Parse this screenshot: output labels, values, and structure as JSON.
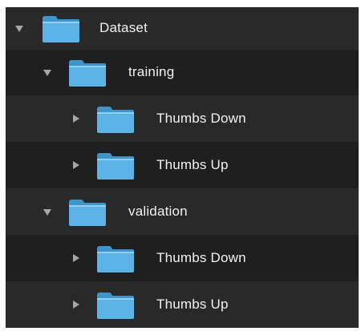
{
  "colors": {
    "background": "#1f1f1f",
    "row_alternate": "#292929",
    "text": "#f2f2f2",
    "disclosure": "#a7a7a7",
    "folder_body": "#5bb4e5",
    "folder_tab": "#3e95cc"
  },
  "tree": {
    "root": {
      "label": "Dataset",
      "expanded": true,
      "icon": "folder-icon"
    },
    "training": {
      "label": "training",
      "expanded": true,
      "icon": "folder-icon",
      "children": [
        {
          "label": "Thumbs Down",
          "expanded": false,
          "icon": "folder-icon"
        },
        {
          "label": "Thumbs Up",
          "expanded": false,
          "icon": "folder-icon"
        }
      ]
    },
    "validation": {
      "label": "validation",
      "expanded": true,
      "icon": "folder-icon",
      "children": [
        {
          "label": "Thumbs Down",
          "expanded": false,
          "icon": "folder-icon"
        },
        {
          "label": "Thumbs Up",
          "expanded": false,
          "icon": "folder-icon"
        }
      ]
    }
  }
}
